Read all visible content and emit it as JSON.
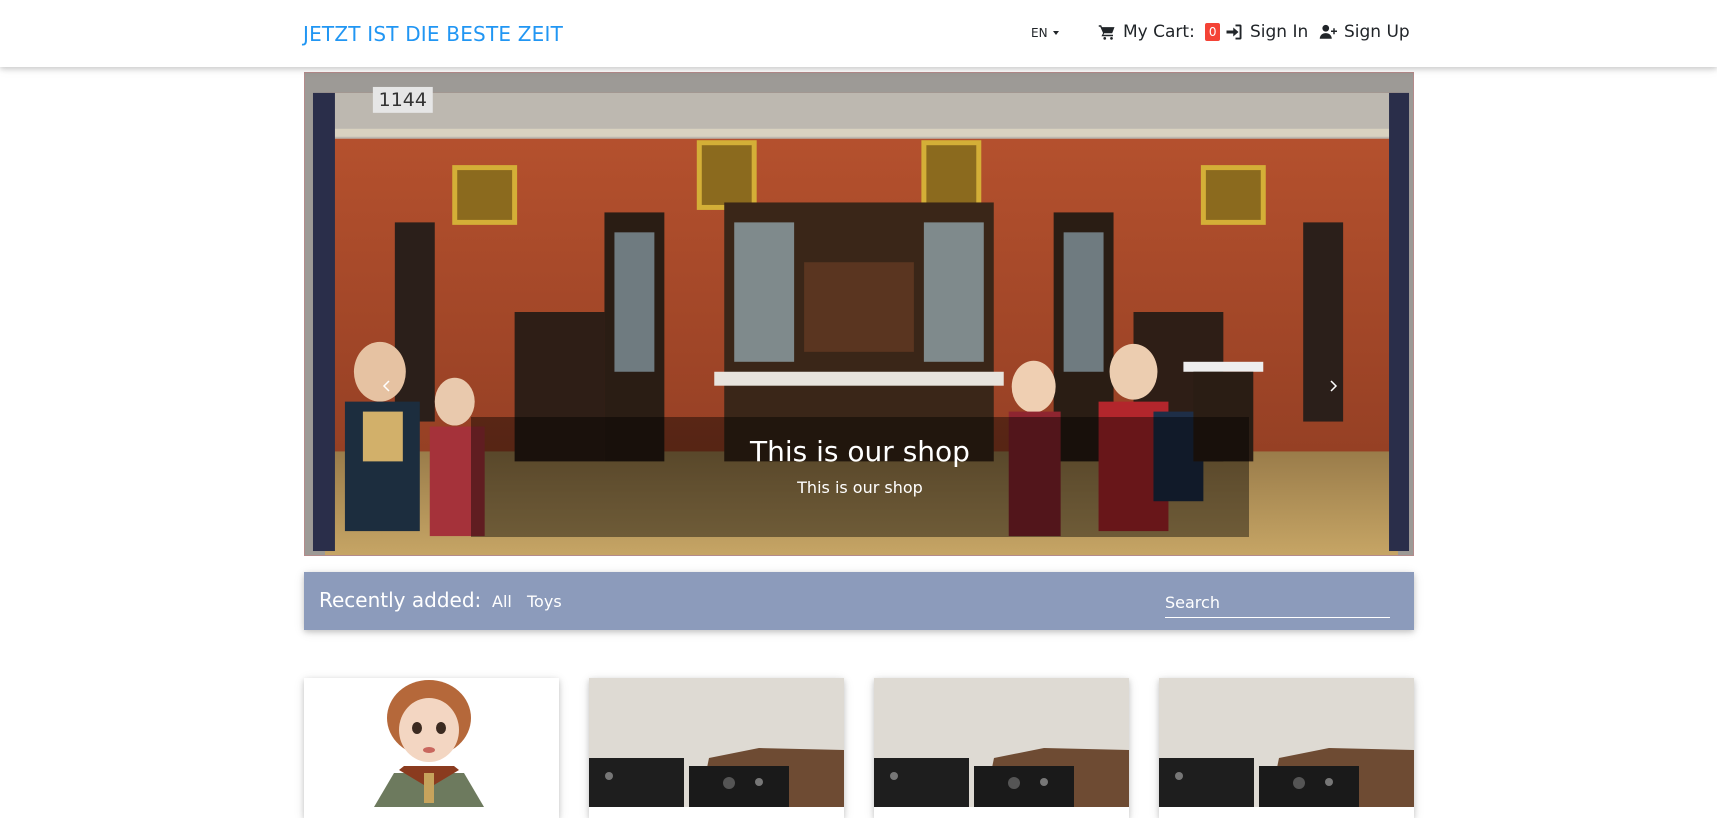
{
  "navbar": {
    "brand": "JETZT IST DIE BESTE ZEIT",
    "language": "EN",
    "cart_label": "My Cart:",
    "cart_count": "0",
    "sign_in": "Sign In",
    "sign_up": "Sign Up"
  },
  "carousel": {
    "image_label": "1144",
    "caption_title": "This is our shop",
    "caption_text": "This is our shop"
  },
  "filters": {
    "heading": "Recently added:",
    "categories": [
      "All",
      "Toys"
    ],
    "search_placeholder": "Search"
  },
  "colors": {
    "brand": "#2196f3",
    "badge": "#f44336",
    "filter_bar": "#8c9bbb"
  },
  "icons": [
    "shopping-cart-icon",
    "sign-in-icon",
    "user-plus-icon",
    "chevron-left-icon",
    "chevron-right-icon"
  ]
}
